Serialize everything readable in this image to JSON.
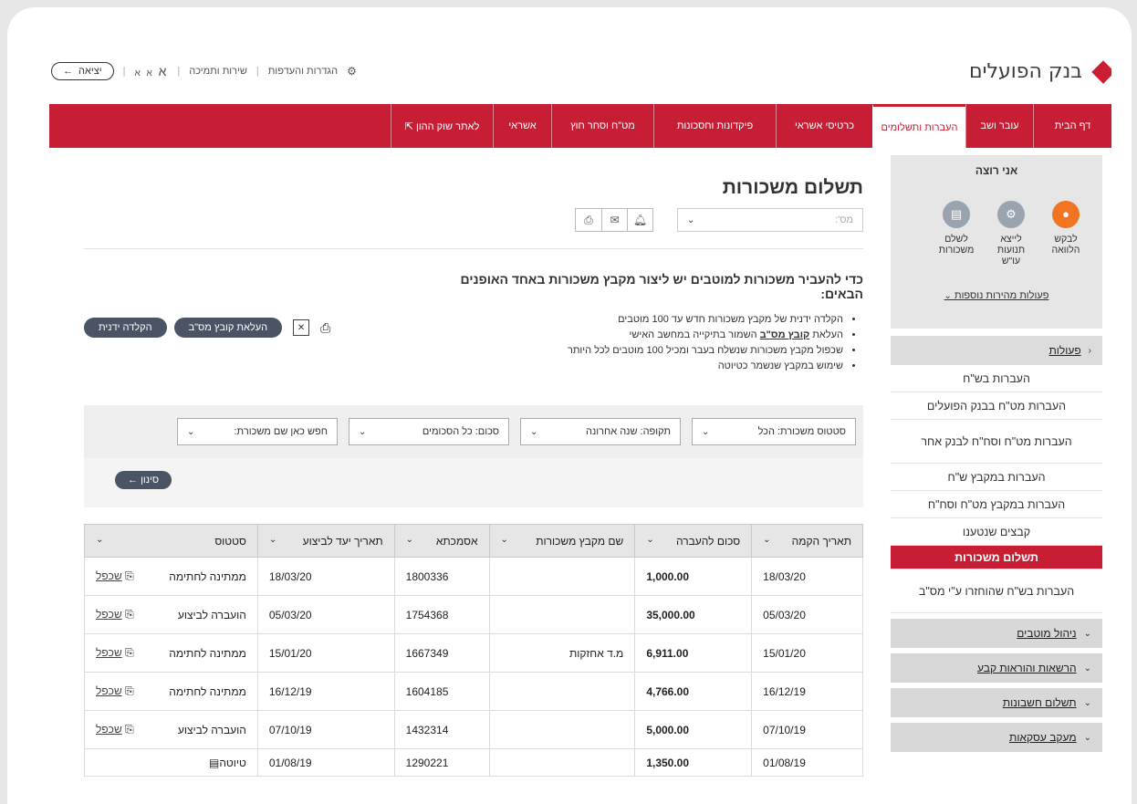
{
  "header": {
    "bank_name": "בנק הפועלים",
    "utilities": {
      "settings": "הגדרות והעדפות",
      "service": "שירות ותמיכה",
      "font_sizes": [
        "א",
        "א",
        "א"
      ],
      "exit": "יציאה"
    }
  },
  "nav": {
    "items": [
      {
        "label": "דף הבית",
        "width": 86
      },
      {
        "label": "עובר ושב",
        "width": 74
      },
      {
        "label": "העברות ותשלומים",
        "width": 102,
        "active": true
      },
      {
        "label": "כרטיסי אשראי",
        "width": 106
      },
      {
        "label": "פיקדונות וחסכונות",
        "width": 134
      },
      {
        "label": "מט\"ח וסחר חוץ",
        "width": 112
      },
      {
        "label": "אשראי",
        "width": 64
      },
      {
        "label": "לאתר שוק ההון ⇱",
        "width": 112
      }
    ]
  },
  "sidebar": {
    "want_title": "אני רוצה",
    "quick_actions": [
      {
        "label": "לבקש הלוואה",
        "color": "#f07421",
        "icon": "bag-icon",
        "glyph": "●"
      },
      {
        "label": "לייצא תנועות עו\"ש",
        "color": "#9aa3b0",
        "icon": "export-icon",
        "glyph": "⚙"
      },
      {
        "label": "לשלם משכורות",
        "color": "#9aa3b0",
        "icon": "document-icon",
        "glyph": "▤"
      }
    ],
    "more_actions": "פעולות מהירות נוספות",
    "actions_title": "פעולות",
    "actions": [
      {
        "label": "העברות בש\"ח"
      },
      {
        "label": "העברות מט\"ח בבנק הפועלים"
      },
      {
        "label": "העברות מט\"ח וסח\"ח לבנק אחר",
        "tall": true
      },
      {
        "label": "העברות במקבץ ש\"ח"
      },
      {
        "label": "העברות במקבץ מט\"ח וסח\"ח"
      },
      {
        "label": "קבצים שנטענו"
      },
      {
        "label": "תשלום משכורות",
        "active": true
      },
      {
        "label": "העברות בש\"ח שהוחזרו ע\"י מס\"ב",
        "tall": true
      }
    ],
    "sections": [
      "ניהול מוטבים",
      "הרשאות והוראות קבע",
      "תשלום חשבונות",
      "מעקב עסקאות"
    ]
  },
  "main": {
    "title": "תשלום משכורות",
    "account_placeholder": "מס':",
    "intro": "כדי להעביר משכורות למוטבים יש ליצור מקבץ משכורות באחד האופנים הבאים:",
    "bullets": [
      {
        "pre": "הקלדה ידנית של מקבץ משכורות חדש עד 100 מוטבים",
        "link": "",
        "post": ""
      },
      {
        "pre": "העלאת ",
        "link": "קובץ מס\"ב",
        "post": " השמור בתיקייה במחשב האישי"
      },
      {
        "pre": "שכפול מקבץ משכורות שנשלח בעבר ומכיל 100 מוטבים לכל היותר",
        "link": "",
        "post": ""
      },
      {
        "pre": "שימוש במקבץ שנשמר כטיוטה",
        "link": "",
        "post": ""
      }
    ],
    "buttons": {
      "manual": "הקלדה ידנית",
      "upload": "העלאת קובץ מס\"ב"
    },
    "filters": {
      "status": "סטטוס משכורת: הכל",
      "period": "תקופה: שנה אחרונה",
      "amount": "סכום: כל הסכומים",
      "search": "חפש כאן שם משכורת:"
    },
    "sort_button": "סינון"
  },
  "table": {
    "headers": [
      "תאריך הקמה",
      "סכום להעברה",
      "שם מקבץ משכורות",
      "אסמכתא",
      "תאריך יעד לביצוע",
      "סטטוס"
    ],
    "copy_label": "שכפל",
    "rows": [
      {
        "created": "18/03/20",
        "amount": "1,000.00",
        "name": "",
        "ref": "1800336",
        "target": "18/03/20",
        "status": "ממתינה לחתימה",
        "copy": true
      },
      {
        "created": "05/03/20",
        "amount": "35,000.00",
        "name": "",
        "ref": "1754368",
        "target": "05/03/20",
        "status": "הועברה לביצוע",
        "copy": true
      },
      {
        "created": "15/01/20",
        "amount": "6,911.00",
        "name": "מ.ד אחזקות",
        "ref": "1667349",
        "target": "15/01/20",
        "status": "ממתינה לחתימה",
        "copy": true
      },
      {
        "created": "16/12/19",
        "amount": "4,766.00",
        "name": "",
        "ref": "1604185",
        "target": "16/12/19",
        "status": "ממתינה לחתימה",
        "copy": true
      },
      {
        "created": "07/10/19",
        "amount": "5,000.00",
        "name": "",
        "ref": "1432314",
        "target": "07/10/19",
        "status": "הועברה לביצוע",
        "copy": true
      },
      {
        "created": "01/08/19",
        "amount": "1,350.00",
        "name": "",
        "ref": "1290221",
        "target": "01/08/19",
        "status": "טיוטה",
        "copy": false
      }
    ]
  }
}
